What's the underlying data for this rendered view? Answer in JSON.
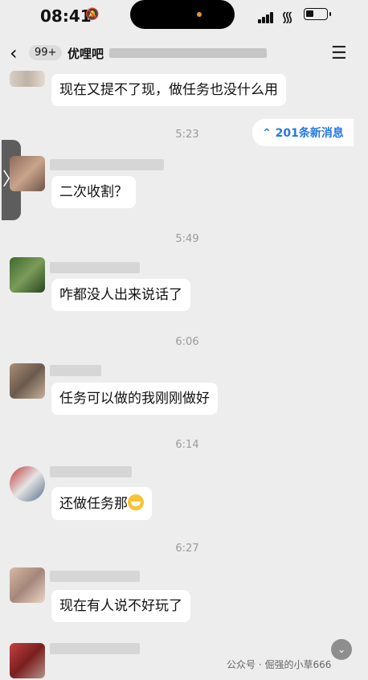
{
  "status": {
    "time": "08:41"
  },
  "header": {
    "back_badge": "99+",
    "title_visible": "优哩吧"
  },
  "side_tab": {
    "glyph": "〉"
  },
  "new_messages": {
    "label": "201条新消息",
    "icon": "double-chevron-up-icon"
  },
  "messages": [
    {
      "text": "现在又提不了现，做任务也没什么用"
    },
    {
      "time": "5:23",
      "text": "二次收割？"
    },
    {
      "time": "5:49",
      "text": "咋都没人出来说话了"
    },
    {
      "time": "6:06",
      "text": "任务可以做的我刚刚做好"
    },
    {
      "time": "6:14",
      "text": "还做任务那",
      "emoji": "grinning-face"
    },
    {
      "time": "6:27",
      "text": "现在有人说不好玩了"
    }
  ],
  "watermark": {
    "text": "公众号 · 倔强的小草666"
  }
}
